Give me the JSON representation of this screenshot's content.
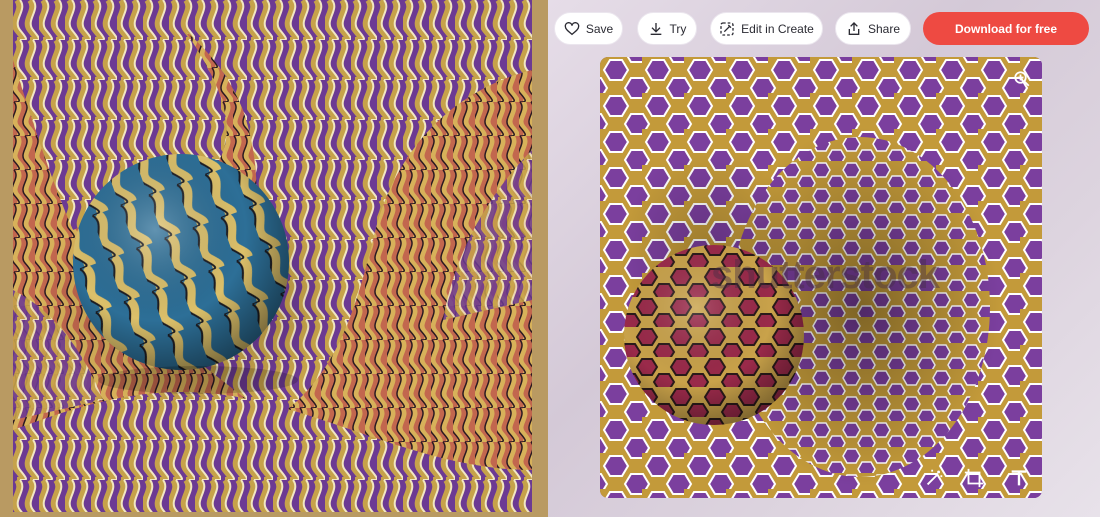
{
  "left_image": {
    "alt": "",
    "colors": {
      "frame": "#b99a62",
      "stripe_purple": "#6c3a93",
      "stripe_gold": "#c6a24a",
      "stripe_cream": "#f1e7c2",
      "stripe_coral": "#c2674e",
      "sphere_blue": "#2d6f97"
    }
  },
  "toolbar": {
    "save_label": "Save",
    "try_label": "Try",
    "edit_label": "Edit in Create",
    "share_label": "Share",
    "download_label": "Download for free",
    "icons": [
      "heart-icon",
      "download-icon",
      "magic-edit-icon",
      "share-icon"
    ]
  },
  "preview": {
    "watermark": "shutterstock",
    "icons": [
      "zoom-in-icon",
      "magic-wand-icon",
      "crop-icon",
      "text-icon"
    ],
    "colors": {
      "hex_purple": "#7b3f9e",
      "hex_gold": "#c39a3a",
      "hex_outline": "#ffffff",
      "sphere_red": "#9a2a4a"
    }
  },
  "colors": {
    "accent": "#ee4a42",
    "pill_bg": "#ffffff"
  }
}
